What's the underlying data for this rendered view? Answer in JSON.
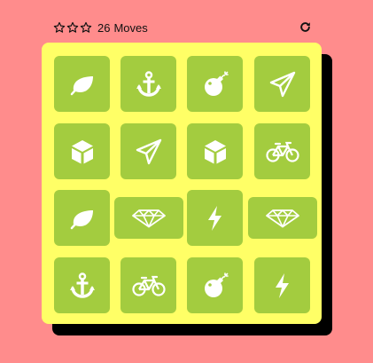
{
  "score_panel": {
    "stars": [
      "star-outline",
      "star-outline",
      "star-outline"
    ],
    "moves_count": "26",
    "moves_label": "Moves",
    "restart_icon": "restart-icon"
  },
  "deck": {
    "cards": [
      {
        "icon": "leaf-icon"
      },
      {
        "icon": "anchor-icon"
      },
      {
        "icon": "bomb-icon"
      },
      {
        "icon": "paper-plane-icon"
      },
      {
        "icon": "cube-icon"
      },
      {
        "icon": "paper-plane-icon"
      },
      {
        "icon": "cube-icon"
      },
      {
        "icon": "bicycle-icon"
      },
      {
        "icon": "leaf-icon"
      },
      {
        "icon": "diamond-icon"
      },
      {
        "icon": "bolt-icon"
      },
      {
        "icon": "diamond-icon"
      },
      {
        "icon": "anchor-icon"
      },
      {
        "icon": "bicycle-icon"
      },
      {
        "icon": "bomb-icon"
      },
      {
        "icon": "bolt-icon"
      }
    ]
  },
  "colors": {
    "background": "#ff8c8c",
    "deck": "#ffff66",
    "card": "#a3cc3f",
    "icon": "#ffffff"
  }
}
